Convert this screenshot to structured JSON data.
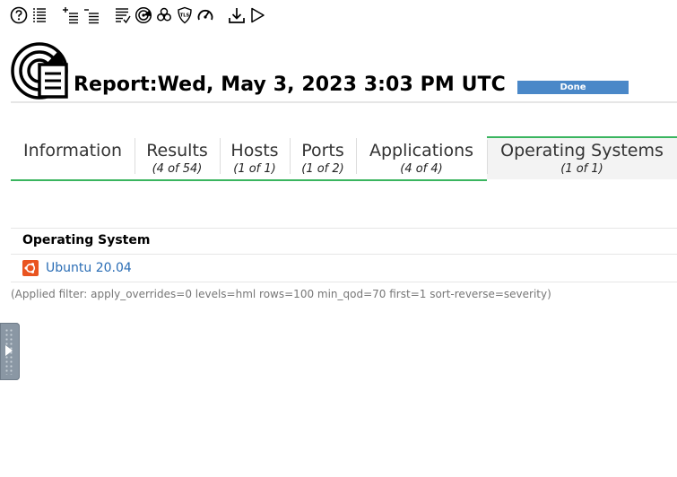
{
  "toolbar": {
    "icons": [
      "help-icon",
      "list-icon",
      "add-filter-icon",
      "filter-list-icon",
      "task-notes-icon",
      "scan-target-icon",
      "biohazard-icon",
      "tls-shield-icon",
      "performance-gauge-icon",
      "download-icon",
      "start-play-icon"
    ]
  },
  "report": {
    "title": "Report:Wed, May 3, 2023 3:03 PM UTC",
    "status": {
      "label": "Done",
      "progress_percent": 100,
      "color": "#4a88c8"
    }
  },
  "tabs": [
    {
      "label": "Information",
      "count": ""
    },
    {
      "label": "Results",
      "count": "(4 of 54)"
    },
    {
      "label": "Hosts",
      "count": "(1 of 1)"
    },
    {
      "label": "Ports",
      "count": "(1 of 2)"
    },
    {
      "label": "Applications",
      "count": "(4 of 4)"
    },
    {
      "label": "Operating Systems",
      "count": "(1 of 1)",
      "active": true
    }
  ],
  "os_table": {
    "header": "Operating System",
    "rows": [
      {
        "name": "Ubuntu 20.04",
        "icon": "ubuntu-icon"
      }
    ]
  },
  "filter_text": "(Applied filter: apply_overrides=0 levels=hml rows=100 min_qod=70 first=1 sort-reverse=severity)",
  "colors": {
    "accent_green": "#3ab55f",
    "link_blue": "#2a6db5",
    "ubuntu_orange": "#e95420"
  }
}
